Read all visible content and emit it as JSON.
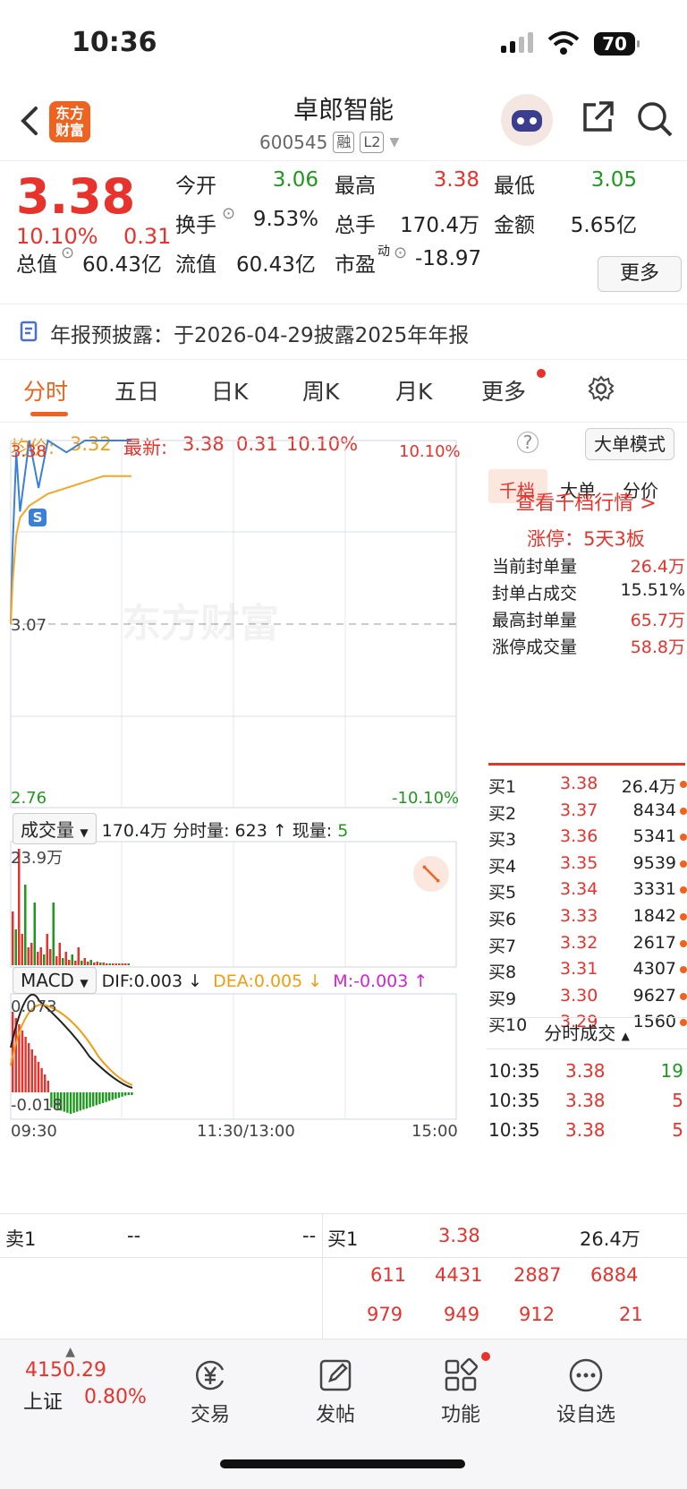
{
  "status_bar": {
    "time": "10:36",
    "battery": "70"
  },
  "header": {
    "title": "卓郎智能",
    "code": "600545",
    "tag1": "融",
    "tag2": "L2",
    "logo_text": "东方财富"
  },
  "quote": {
    "price": "3.38",
    "change_pct": "10.10%",
    "change": "0.31",
    "open_label": "今开",
    "open": "3.06",
    "high_label": "最高",
    "high": "3.38",
    "low_label": "最低",
    "low": "3.05",
    "turnover_label": "换手",
    "turnover": "9.53%",
    "volume_label": "总手",
    "volume": "170.4万",
    "amount_label": "金额",
    "amount": "5.65亿",
    "mktcap_label": "总值",
    "mktcap": "60.43亿",
    "float_label": "流值",
    "float": "60.43亿",
    "pe_label": "市盈",
    "pe_sup": "动",
    "pe": "-18.97",
    "more": "更多"
  },
  "notice": "年报预披露：于2026-04-29披露2025年年报",
  "tabs": [
    "分时",
    "五日",
    "日K",
    "周K",
    "月K",
    "更多"
  ],
  "infobar": {
    "avg_label": "均价:",
    "avg": "3.32",
    "latest_label": "最新:",
    "latest": "3.38",
    "chg": "0.31",
    "pct": "10.10%",
    "mode": "大单模式"
  },
  "chart": {
    "y_top": "3.38",
    "y_mid": "3.07",
    "y_bottom": "2.76",
    "pct_top": "10.10%",
    "pct_bottom": "-10.10%",
    "watermark": "东方财富",
    "marker": "S",
    "vol_select": "成交量",
    "vol_info": "170.4万 分时量: 623 ↑ 现量:",
    "vol_now": "5",
    "vol_max": "23.9万",
    "macd_select": "MACD",
    "dif": "DIF:0.003 ↓",
    "dea": "DEA:0.005 ↓",
    "m": "M:-0.003 ↑",
    "macd_top": "0.073",
    "macd_bottom": "-0.018",
    "time_start": "09:30",
    "time_mid": "11:30/13:00",
    "time_end": "15:00"
  },
  "chart_data": {
    "type": "line",
    "x_range": [
      "09:30",
      "15:00"
    ],
    "ylim": [
      2.76,
      3.38
    ],
    "series": [
      {
        "name": "最新",
        "x": [
          "09:30",
          "09:31",
          "09:33",
          "09:35",
          "09:40",
          "09:45",
          "09:50",
          "10:00",
          "10:10",
          "10:20",
          "10:35"
        ],
        "values": [
          3.07,
          3.2,
          3.36,
          3.26,
          3.38,
          3.3,
          3.38,
          3.36,
          3.38,
          3.38,
          3.38
        ]
      },
      {
        "name": "均价",
        "x": [
          "09:30",
          "09:31",
          "09:33",
          "09:35",
          "09:40",
          "09:50",
          "10:00",
          "10:10",
          "10:20",
          "10:35"
        ],
        "values": [
          3.07,
          3.14,
          3.22,
          3.25,
          3.27,
          3.29,
          3.3,
          3.31,
          3.32,
          3.32
        ]
      }
    ]
  },
  "panel": {
    "tabs": [
      "千档",
      "大单",
      "分价"
    ],
    "link": "查看千档行情 >",
    "limit": "涨停：5天3板",
    "stats": [
      {
        "label": "当前封单量",
        "value": "26.4万"
      },
      {
        "label": "封单占成交",
        "value": "15.51%"
      },
      {
        "label": "最高封单量",
        "value": "65.7万"
      },
      {
        "label": "涨停成交量",
        "value": "58.8万"
      }
    ],
    "bids": [
      {
        "label": "买1",
        "price": "3.38",
        "qty": "26.4万"
      },
      {
        "label": "买2",
        "price": "3.37",
        "qty": "8434"
      },
      {
        "label": "买3",
        "price": "3.36",
        "qty": "5341"
      },
      {
        "label": "买4",
        "price": "3.35",
        "qty": "9539"
      },
      {
        "label": "买5",
        "price": "3.34",
        "qty": "3331"
      },
      {
        "label": "买6",
        "price": "3.33",
        "qty": "1842"
      },
      {
        "label": "买7",
        "price": "3.32",
        "qty": "2617"
      },
      {
        "label": "买8",
        "price": "3.31",
        "qty": "4307"
      },
      {
        "label": "买9",
        "price": "3.30",
        "qty": "9627"
      },
      {
        "label": "买10",
        "price": "3.29",
        "qty": "1560"
      }
    ],
    "ticks_header": "分时成交",
    "ticks": [
      {
        "time": "10:35",
        "price": "3.38",
        "qty": "19"
      },
      {
        "time": "10:35",
        "price": "3.38",
        "qty": "5"
      },
      {
        "time": "10:35",
        "price": "3.38",
        "qty": "5"
      }
    ]
  },
  "book": {
    "sell_label": "卖1",
    "sell_price": "--",
    "sell_qty": "--",
    "buy_label": "买1",
    "buy_price": "3.38",
    "buy_qty": "26.4万",
    "row1": [
      "611",
      "4431",
      "2887",
      "6884"
    ],
    "row2": [
      "979",
      "949",
      "912",
      "21"
    ]
  },
  "bottom_nav": {
    "index_value": "4150.29",
    "index_name": "上证",
    "index_pct": "0.80%",
    "trade": "交易",
    "post": "发帖",
    "func": "功能",
    "watch": "设自选"
  }
}
